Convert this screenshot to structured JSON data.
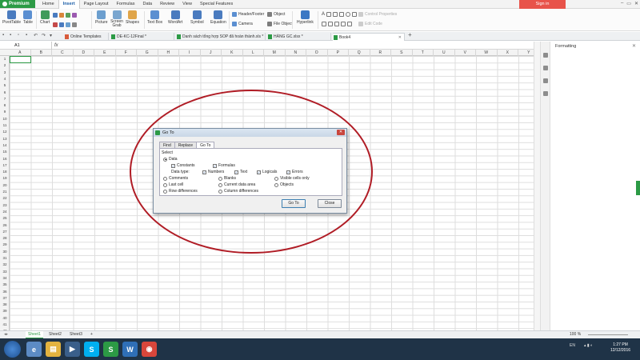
{
  "app": {
    "premium_label": "Premium",
    "menu_tabs": [
      "Home",
      "Insert",
      "Page Layout",
      "Formulas",
      "Data",
      "Review",
      "View",
      "Special Features"
    ],
    "active_tab": "Insert",
    "signin_label": "Sign in"
  },
  "ribbon": {
    "pivottable": "PivotTable",
    "table": "Table",
    "chart": "Chart",
    "picture": "Picture",
    "screen_grab": "Screen Grab",
    "shapes": "Shapes",
    "textbox": "Text Box",
    "wordart": "WordArt",
    "symbol": "Symbol",
    "equation": "Equation",
    "header_footer": "Header/Footer",
    "camera": "Camera",
    "object": "Object",
    "file_object": "File Object",
    "hyperlink": "Hyperlink",
    "control_properties": "Control Properties",
    "edit_code": "Edit Code"
  },
  "doc_tabs": [
    {
      "label": "Online Templates",
      "active": false
    },
    {
      "label": "DE-KC-12Final",
      "active": false
    },
    {
      "label": "Danh sách tổng hợp SOP đã hoàn thành.xls",
      "active": false
    },
    {
      "label": "HÀNG GC.xlsx",
      "active": false
    },
    {
      "label": "Book4",
      "active": true
    }
  ],
  "formula_bar": {
    "name_box": "A1",
    "fx": "fx"
  },
  "columns": [
    "A",
    "B",
    "C",
    "D",
    "E",
    "F",
    "G",
    "H",
    "I",
    "J",
    "K",
    "L",
    "M",
    "N",
    "O",
    "P",
    "Q",
    "R",
    "S",
    "T",
    "U",
    "V",
    "W",
    "X",
    "Y"
  ],
  "rows": [
    "1",
    "2",
    "3",
    "4",
    "5",
    "6",
    "7",
    "8",
    "9",
    "10",
    "11",
    "12",
    "13",
    "14",
    "15",
    "16",
    "17",
    "18",
    "19",
    "20",
    "21",
    "22",
    "23",
    "24",
    "25",
    "26",
    "27",
    "28",
    "29",
    "30",
    "31",
    "32",
    "33",
    "34",
    "35",
    "36",
    "37",
    "38",
    "39",
    "40",
    "41",
    "42"
  ],
  "right_panel": {
    "title": "Formatting"
  },
  "dialog": {
    "title": "Go To",
    "tabs": [
      "Find",
      "Replace",
      "Go To"
    ],
    "active_tab": "Go To",
    "section": "Select",
    "data_label": "Data",
    "constants": "Constants",
    "formulas": "Formulas",
    "data_type": "Data type:",
    "numbers": "Numbers",
    "text": "Text",
    "logicals": "Logicals",
    "errors": "Errors",
    "comments": "Comments",
    "blanks": "Blanks",
    "visible_cells_only": "Visible cells only",
    "last_cell": "Last cell",
    "current_data_area": "Current data area",
    "objects": "Objects",
    "row_differences": "Row differences",
    "column_differences": "Column differences",
    "goto_button": "Go To",
    "close_button": "Close"
  },
  "sheets": [
    "Sheet1",
    "Sheet2",
    "Sheet3"
  ],
  "status": {
    "zoom": "100 %"
  },
  "taskbar": {
    "lang": "EN",
    "time": "1:27 PM",
    "date": "12/12/2016",
    "apps": [
      "S",
      "W"
    ]
  },
  "colors": {
    "accent_green": "#2c9a45",
    "annotation_red": "#b01c25",
    "signin_red": "#e8534a",
    "taskbar": "#1f3347"
  }
}
